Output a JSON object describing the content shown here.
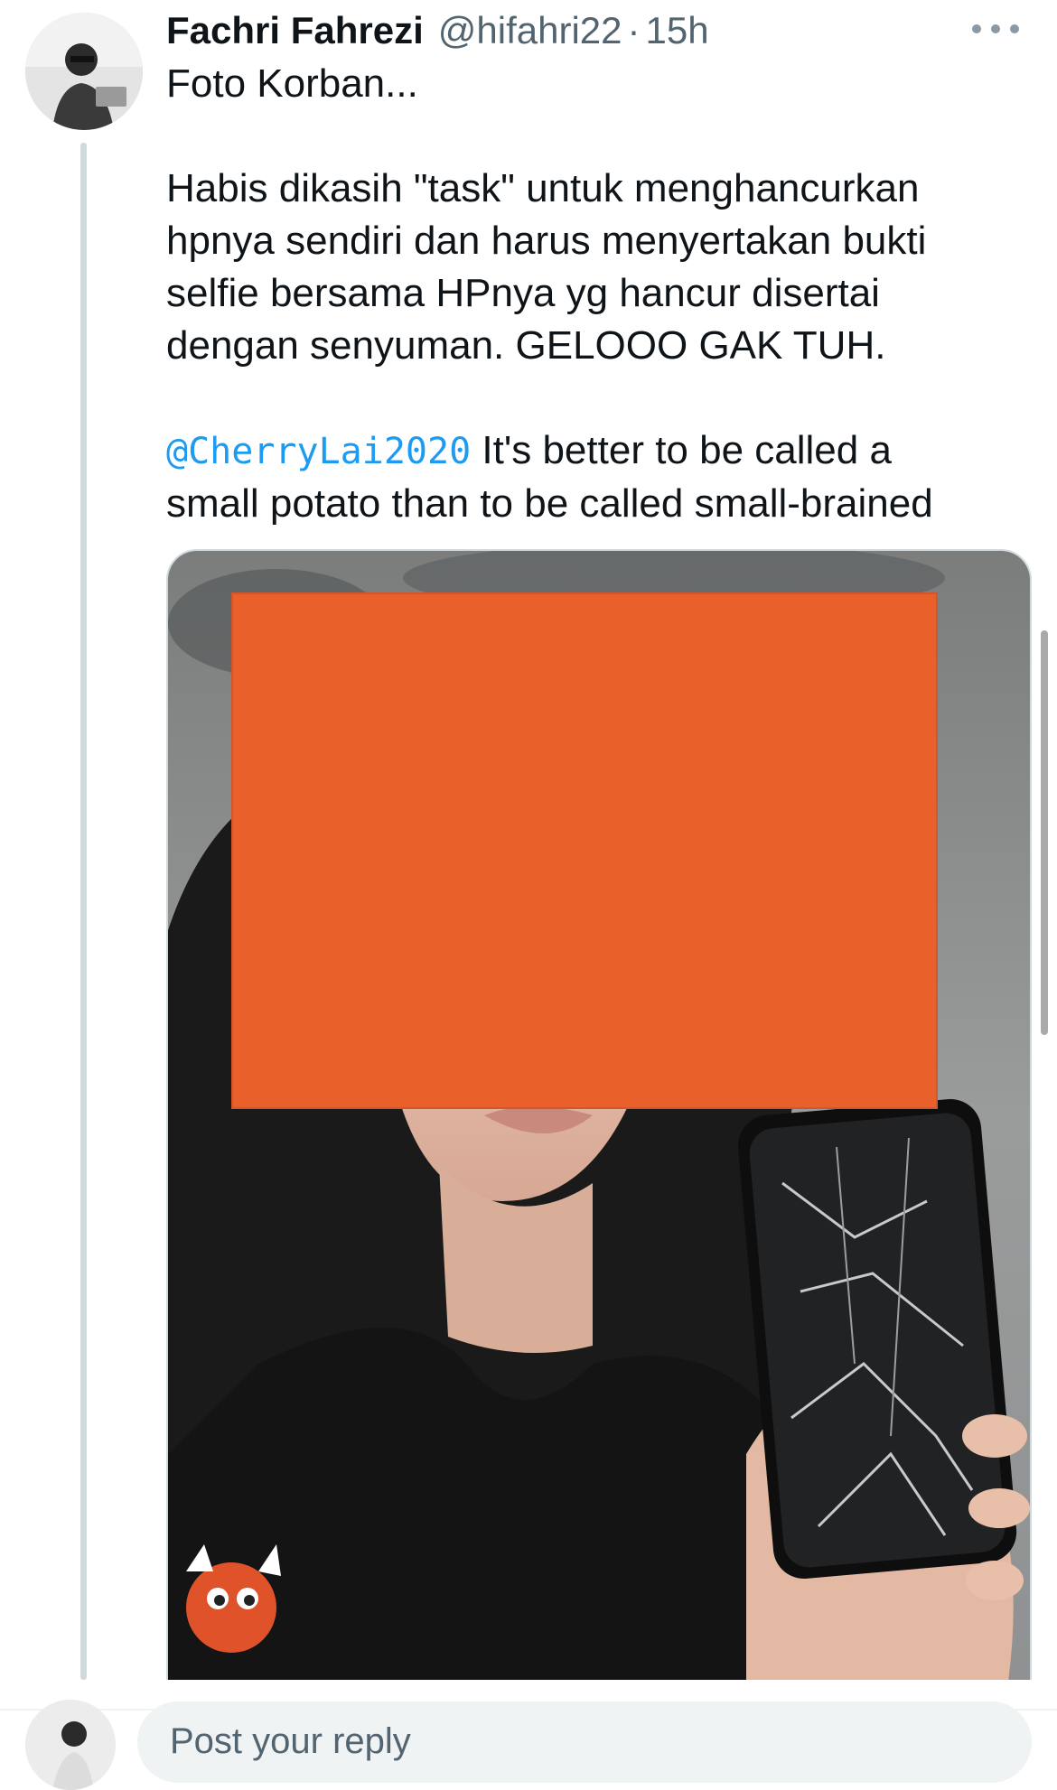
{
  "tweet": {
    "author_name": "Fachri Fahrezi",
    "author_handle": "@hifahri22",
    "separator": "·",
    "time": "15h",
    "text_line1": "Foto Korban...",
    "text_paragraph2": "Habis dikasih \"task\" untuk menghancurkan hpnya sendiri dan harus menyertakan bukti selfie bersama HPnya yg hancur disertai dengan senyuman. GELOOO GAK TUH.",
    "quoted_mention": "@CherryLai2020",
    "quoted_text": " It's better to be called a small potato than to be called small-brained"
  },
  "icons": {
    "more": "more-horizontal-icon",
    "avatar": "user-avatar",
    "media": "photo-attachment"
  },
  "colors": {
    "link": "#1d9bf0",
    "secondary_text": "#536471",
    "redaction": "#e9602a"
  },
  "reply": {
    "placeholder": "Post your reply"
  }
}
